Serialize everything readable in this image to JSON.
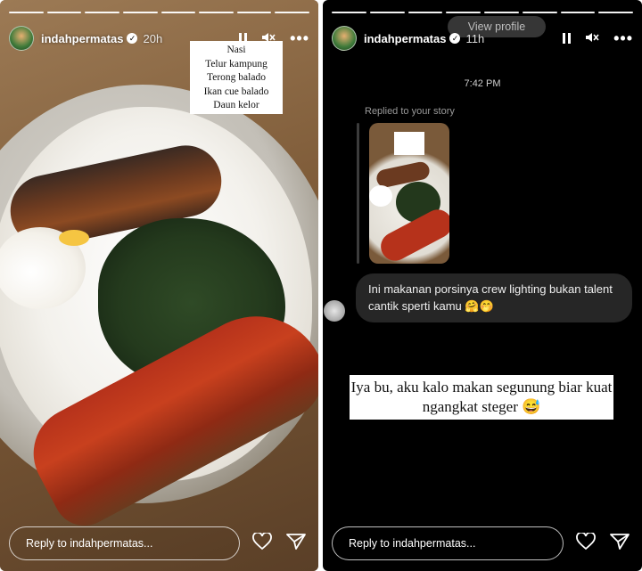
{
  "left_story": {
    "username": "indahpermatas",
    "time_ago": "20h",
    "progress_total": 8,
    "progress_current": 8,
    "menu_caption": [
      "Nasi",
      "Telur kampung",
      "Terong balado",
      "Ikan cue balado",
      "Daun kelor"
    ],
    "reply_placeholder": "Reply to indahpermatas..."
  },
  "right_story": {
    "username": "indahpermatas",
    "time_ago": "11h",
    "view_profile_label": "View profile",
    "progress_total": 8,
    "progress_current": 8,
    "timestamp": "7:42 PM",
    "replied_label": "Replied to your story",
    "message": "Ini makanan porsinya crew lighting bukan talent cantik sperti kamu 🤗🤭",
    "overlay_caption": "Iya bu, aku kalo makan segunung biar kuat ngangkat steger 😅",
    "reply_placeholder": "Reply to indahpermatas..."
  },
  "icons": {
    "verified": "verified-badge-icon",
    "pause": "pause-icon",
    "mute": "mute-icon",
    "more": "more-icon",
    "heart": "heart-icon",
    "send": "send-icon"
  }
}
